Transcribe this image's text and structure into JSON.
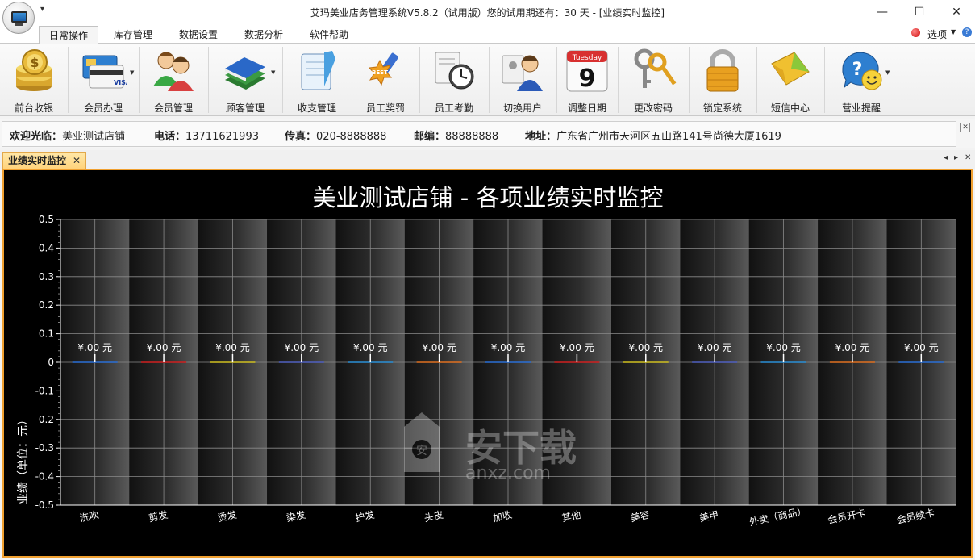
{
  "window": {
    "title": "艾玛美业店务管理系统V5.8.2（试用版）您的试用期还有：30 天 - [业绩实时监控]",
    "minimize": "—",
    "maximize": "☐",
    "close": "✕"
  },
  "ribbon_tabs": [
    "日常操作",
    "库存管理",
    "数据设置",
    "数据分析",
    "软件帮助"
  ],
  "options": {
    "label": "选项",
    "help": "?"
  },
  "toolbar": [
    {
      "label": "前台收银",
      "icon": "coins-icon"
    },
    {
      "label": "会员办理",
      "icon": "member-cards-icon",
      "dropdown": true
    },
    {
      "label": "会员管理",
      "icon": "people-icon"
    },
    {
      "label": "顾客管理",
      "icon": "books-icon",
      "dropdown": true
    },
    {
      "label": "收支管理",
      "icon": "notebook-icon"
    },
    {
      "label": "员工奖罚",
      "icon": "best-badge-icon"
    },
    {
      "label": "员工考勤",
      "icon": "clock-icon"
    },
    {
      "label": "切换用户",
      "icon": "user-switch-icon"
    },
    {
      "label": "调整日期",
      "icon": "calendar-icon",
      "cal_day": "Tuesday",
      "cal_num": "9"
    },
    {
      "label": "更改密码",
      "icon": "keys-icon"
    },
    {
      "label": "锁定系统",
      "icon": "padlock-icon"
    },
    {
      "label": "短信中心",
      "icon": "envelope-icon"
    },
    {
      "label": "营业提醒",
      "icon": "smiley-bubble-icon",
      "dropdown": true
    }
  ],
  "info": {
    "welcome_label": "欢迎光临：",
    "welcome_value": "美业测试店铺",
    "phone_label": "电话：",
    "phone_value": "13711621993",
    "fax_label": "传真：",
    "fax_value": "020-8888888",
    "zip_label": "邮编：",
    "zip_value": "88888888",
    "address_label": "地址：",
    "address_value": "广东省广州市天河区五山路141号尚德大厦1619",
    "close": "✕"
  },
  "doc_tab": {
    "label": "业绩实时监控",
    "close": "✕"
  },
  "chart_data": {
    "type": "bar",
    "title": "美业测试店铺 - 各项业绩实时监控",
    "ylabel": "业绩（单位：元）",
    "xlabel": "",
    "categories": [
      "洗吹",
      "剪发",
      "烫发",
      "染发",
      "护发",
      "头皮",
      "加收",
      "其他",
      "美容",
      "美甲",
      "外卖（商品）",
      "会员开卡",
      "会员续卡"
    ],
    "values": [
      0,
      0,
      0,
      0,
      0,
      0,
      0,
      0,
      0,
      0,
      0,
      0,
      0
    ],
    "value_labels": [
      "¥.00 元",
      "¥.00 元",
      "¥.00 元",
      "¥.00 元",
      "¥.00 元",
      "¥.00 元",
      "¥.00 元",
      "¥.00 元",
      "¥.00 元",
      "¥.00 元",
      "¥.00 元",
      "¥.00 元",
      "¥.00 元"
    ],
    "bar_colors": [
      "#2a6fd6",
      "#d02020",
      "#d0c020",
      "#5060c0",
      "#2a8fd6",
      "#e07020",
      "#2a6fd6",
      "#d02020",
      "#d0c020",
      "#5060c0",
      "#2a8fd6",
      "#e07020",
      "#2a6fd6"
    ],
    "ylim": [
      -0.5,
      0.5
    ],
    "yticks": [
      "0.5",
      "0.4",
      "0.3",
      "0.2",
      "0.1",
      "0",
      "-0.1",
      "-0.2",
      "-0.3",
      "-0.4",
      "-0.5"
    ],
    "grid": true,
    "legend": "none"
  },
  "watermark": {
    "text1": "安下载",
    "text2": "anxz.com"
  },
  "colors": {
    "chart_bg": "#000000",
    "frame_accent": "#f0a030",
    "tab_active": "#ffd27a"
  }
}
